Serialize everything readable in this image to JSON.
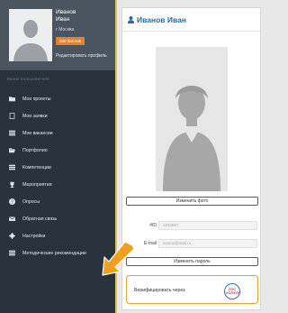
{
  "profile": {
    "first_line": "Иванов",
    "second_line": "Иван",
    "city": "г Москва",
    "badge": "250 баллов",
    "edit_link": "Редактировать профиль"
  },
  "menu": {
    "title": "Меню пользователя",
    "items": [
      {
        "label": "Мои проекты",
        "icon": "folder-icon"
      },
      {
        "label": "Мои заявки",
        "icon": "document-icon"
      },
      {
        "label": "Мои вакансии",
        "icon": "list-icon"
      },
      {
        "label": "Портфолио",
        "icon": "folder-open-icon"
      },
      {
        "label": "Компетенции",
        "icon": "list-icon"
      },
      {
        "label": "Мероприятия",
        "icon": "trophy-icon"
      },
      {
        "label": "Опросы",
        "icon": "question-icon"
      },
      {
        "label": "Обратная связь",
        "icon": "mail-icon"
      },
      {
        "label": "Настройки",
        "icon": "gear-icon"
      },
      {
        "label": "Методические рекомендации",
        "icon": "list-icon"
      }
    ]
  },
  "card": {
    "title": "Иванов Иван",
    "change_photo": "Изменить фото",
    "id_label": "#ID",
    "id_value": "1234567",
    "email_label": "E-mail",
    "email_value": "ivanov@mail.ru",
    "change_password": "Изменить пароль",
    "verify_text": "Верифицировать через",
    "verify_logo": "ГОС УСЛУГИ"
  },
  "colors": {
    "sidebar": "#2a333c",
    "profile_box": "#4a5560",
    "badge": "#e8822a",
    "title": "#2c6a9a",
    "verify_border": "#e8a034",
    "arrow": "#f0a020"
  }
}
